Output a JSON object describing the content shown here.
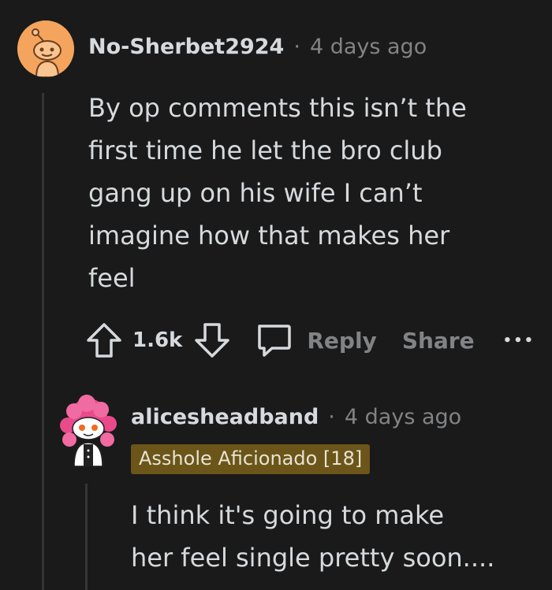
{
  "comments": [
    {
      "username": "No-Sherbet2924",
      "separator": "·",
      "time": "4 days ago",
      "body": "By op comments this isn’t the\nfirst time he let the bro club\ngang up on his wife I can’t\nimagine how that makes her\nfeel",
      "score": "1.6k",
      "reply_label": "Reply",
      "share_label": "Share",
      "more_label": "•••",
      "avatar_icon": "snoo-avatar-icon"
    },
    {
      "username": "alicesheadband",
      "separator": "·",
      "time": "4 days ago",
      "flair": "Asshole Aficionado [18]",
      "body": "I think it's going to make\nher feel single pretty soon....",
      "avatar_icon": "snoo-avatar-icon"
    }
  ],
  "colors": {
    "background": "#1a1a1b",
    "text": "#d7dadc",
    "muted": "#818384",
    "flair_bg": "#6b5519",
    "thread_line": "#343536"
  }
}
